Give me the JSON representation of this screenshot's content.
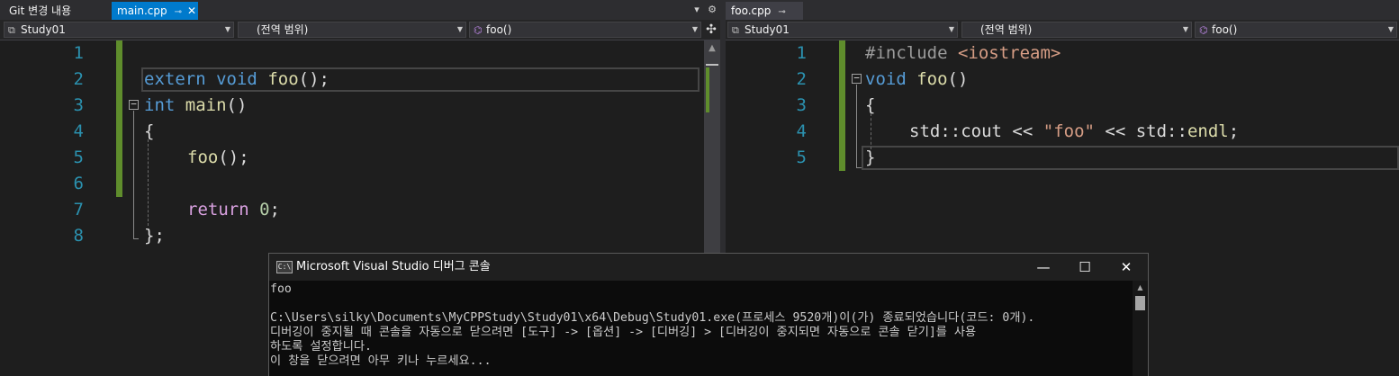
{
  "left": {
    "tabs": [
      {
        "label": "Git 변경 내용"
      },
      {
        "label": "main.cpp",
        "pin": "⊸",
        "close": "✕"
      }
    ],
    "tabbar_buttons": {
      "dropdown": "▾",
      "settings": "⚙"
    },
    "nav": {
      "project": "Study01",
      "scope": "(전역 범위)",
      "member": "foo()"
    },
    "editor": {
      "line_numbers": [
        "1",
        "2",
        "3",
        "4",
        "5",
        "6",
        "7",
        "8"
      ],
      "tokens": {
        "l2_extern": "extern",
        "l2_void": "void",
        "l2_foo": "foo",
        "l2_rest": "();",
        "l3_int": "int",
        "l3_main": "main",
        "l3_parens": "()",
        "l4_brace": "{",
        "l5_foo": "foo",
        "l5_rest": "();",
        "l7_return": "return",
        "l7_zero": "0",
        "l7_semi": ";",
        "l8_close": "};"
      },
      "fold_glyph": "−"
    }
  },
  "right": {
    "tab": {
      "label": "foo.cpp",
      "pin": "⊸"
    },
    "nav": {
      "project": "Study01",
      "scope": "(전역 범위)",
      "member": "foo()"
    },
    "editor": {
      "line_numbers": [
        "1",
        "2",
        "3",
        "4",
        "5"
      ],
      "tokens": {
        "l1_inc": "#include",
        "l1_hdr": "<iostream>",
        "l2_void": "void",
        "l2_foo": "foo",
        "l2_parens": "()",
        "l3_brace": "{",
        "l4_std1": "std",
        "l4_sep1": "::",
        "l4_cout": "cout",
        "l4_op1": " << ",
        "l4_str": "\"foo\"",
        "l4_op2": " << ",
        "l4_std2": "std",
        "l4_sep2": "::",
        "l4_endl": "endl",
        "l4_semi": ";",
        "l5_brace": "}"
      },
      "fold_glyph": "−"
    }
  },
  "console": {
    "title": "Microsoft Visual Studio 디버그 콘솔",
    "icon_text": "C:\\",
    "buttons": {
      "minimize": "—",
      "maximize": "☐",
      "close": "✕"
    },
    "lines": [
      "foo",
      "",
      "C:\\Users\\silky\\Documents\\MyCPPStudy\\Study01\\x64\\Debug\\Study01.exe(프로세스 9520개)이(가) 종료되었습니다(코드: 0개).",
      "디버깅이 중지될 때 콘솔을 자동으로 닫으려면 [도구] -> [옵션] -> [디버깅] > [디버깅이 중지되면 자동으로 콘솔 닫기]를 사용",
      "하도록 설정합니다.",
      "이 창을 닫으려면 아무 키나 누르세요..."
    ]
  },
  "colors": {
    "accent_tab": "#007acc",
    "editor_bg": "#1e1e1e",
    "keyword": "#569cd6",
    "function": "#dcdcaa",
    "line_number": "#2b91af",
    "change_bar": "#5f8d2c",
    "string": "#d69d85",
    "number": "#b5cea8"
  },
  "icons": [
    "project-icon",
    "method-icon",
    "pin-icon",
    "close-icon",
    "settings-icon",
    "split-icon",
    "console-icon",
    "fold-icon"
  ]
}
